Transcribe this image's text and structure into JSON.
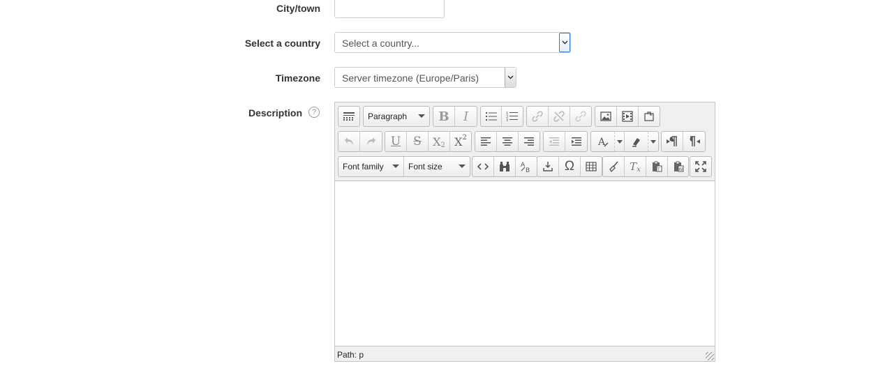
{
  "form": {
    "city": {
      "label": "City/town",
      "value": ""
    },
    "country": {
      "label": "Select a country",
      "selected": "Select a country..."
    },
    "timezone": {
      "label": "Timezone",
      "selected": "Server timezone (Europe/Paris)"
    },
    "description": {
      "label": "Description",
      "help_glyph": "?"
    }
  },
  "editor": {
    "row1": {
      "format_select": "Paragraph"
    },
    "row3": {
      "font_family": "Font family",
      "font_size": "Font size"
    },
    "status_path": "Path: p"
  }
}
